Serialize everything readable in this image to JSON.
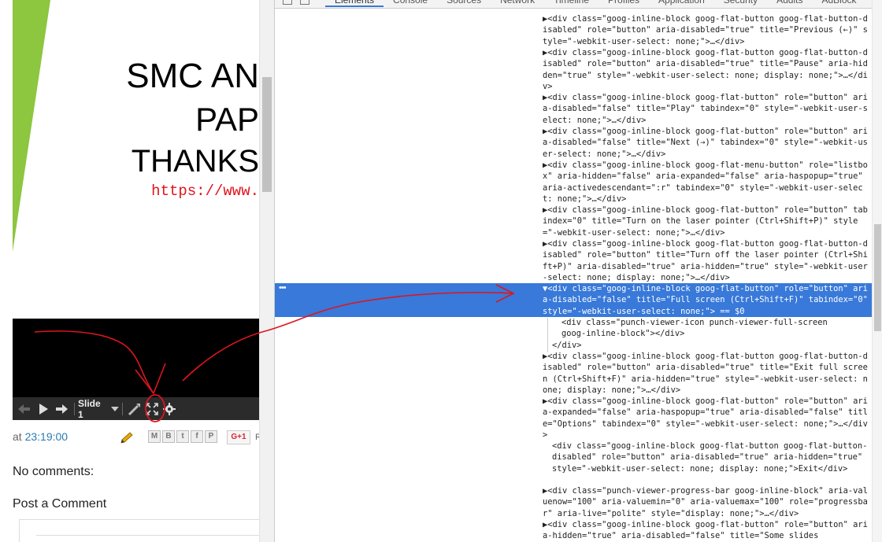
{
  "slide": {
    "line1": "SMC AN",
    "line2": "PAP",
    "line3": "THANKS",
    "url": "https://www.",
    "accent_color": "#8dc63f"
  },
  "player": {
    "prev_icon": "arrow-left-icon",
    "play_icon": "play-icon",
    "next_icon": "arrow-right-icon",
    "slide_label": "Slide 1",
    "laser_icon": "laser-pointer-icon",
    "fullscreen_icon": "fullscreen-icon",
    "options_icon": "gear-icon"
  },
  "post_footer": {
    "at_label": "at ",
    "time": "23:19:00",
    "share_labels": [
      "M",
      "B",
      "t",
      "f",
      "P"
    ],
    "gplus": "G+1",
    "gplus_extra": "R"
  },
  "comments": {
    "no_comments": "No comments:",
    "post_a_comment": "Post a Comment"
  },
  "devtools": {
    "tabs": [
      "Elements",
      "Console",
      "Sources",
      "Network",
      "Timeline",
      "Profiles",
      "Application",
      "Security",
      "Audits",
      "AdBlock"
    ],
    "active_tab": "Elements",
    "selection_color": "#3879d9",
    "dom_nodes": [
      {
        "text": "▶<div class=\"goog-inline-block goog-flat-button goog-flat-button-disabled\" role=\"button\" aria-disabled=\"true\" title=\"Previous (←)\" style=\"-webkit-user-select: none;\">…</div>"
      },
      {
        "text": "▶<div class=\"goog-inline-block goog-flat-button goog-flat-button-disabled\" role=\"button\" aria-disabled=\"true\" title=\"Pause\" aria-hidden=\"true\" style=\"-webkit-user-select: none; display: none;\">…</div>"
      },
      {
        "text": "▶<div class=\"goog-inline-block goog-flat-button\" role=\"button\" aria-disabled=\"false\" title=\"Play\" tabindex=\"0\" style=\"-webkit-user-select: none;\">…</div>"
      },
      {
        "text": "▶<div class=\"goog-inline-block goog-flat-button\" role=\"button\" aria-disabled=\"false\" title=\"Next (→)\" tabindex=\"0\" style=\"-webkit-user-select: none;\">…</div>"
      },
      {
        "text": "▶<div class=\"goog-inline-block goog-flat-menu-button\" role=\"listbox\" aria-hidden=\"false\" aria-expanded=\"false\" aria-haspopup=\"true\" aria-activedescendant=\":r\" tabindex=\"0\" style=\"-webkit-user-select: none;\">…</div>"
      },
      {
        "text": "▶<div class=\"goog-inline-block goog-flat-button\" role=\"button\" tabindex=\"0\" title=\"Turn on the laser pointer (Ctrl+Shift+P)\" style=\"-webkit-user-select: none;\">…</div>"
      },
      {
        "text": "▶<div class=\"goog-inline-block goog-flat-button goog-flat-button-disabled\" role=\"button\" title=\"Turn off the laser pointer (Ctrl+Shift+P)\" aria-disabled=\"true\" aria-hidden=\"true\" style=\"-webkit-user-select: none; display: none;\">…</div>"
      },
      {
        "text": "▼<div class=\"goog-inline-block goog-flat-button\" role=\"button\" aria-disabled=\"false\" title=\"Full screen (Ctrl+Shift+F)\" tabindex=\"0\" style=\"-webkit-user-select: none;\"> == $0"
      },
      {
        "text": "<div class=\"punch-viewer-icon punch-viewer-full-screen goog-inline-block\"></div>"
      },
      {
        "text": "</div>"
      },
      {
        "text": "▶<div class=\"goog-inline-block goog-flat-button goog-flat-button-disabled\" role=\"button\" aria-disabled=\"true\" title=\"Exit full screen (Ctrl+Shift+F)\" aria-hidden=\"true\" style=\"-webkit-user-select: none; display: none;\">…</div>"
      },
      {
        "text": "▶<div class=\"goog-inline-block goog-flat-button\" role=\"button\" aria-expanded=\"false\" aria-haspopup=\"true\" aria-disabled=\"false\" title=\"Options\" tabindex=\"0\" style=\"-webkit-user-select: none;\">…</div>"
      },
      {
        "text": "<div class=\"goog-inline-block goog-flat-button goog-flat-button-disabled\" role=\"button\" aria-disabled=\"true\" aria-hidden=\"true\" style=\"-webkit-user-select: none; display: none;\">Exit</div>"
      },
      {
        "text": "▶<div class=\"punch-viewer-progress-bar goog-inline-block\" aria-valuenow=\"100\" aria-valuemin=\"0\" aria-valuemax=\"100\" role=\"progressbar\" aria-live=\"polite\" style=\"display: none;\">…</div>"
      },
      {
        "text": "▶<div class=\"goog-inline-block goog-flat-button\" role=\"button\" aria-hidden=\"true\" aria-disabled=\"false\" title=\"Some slides"
      }
    ]
  }
}
